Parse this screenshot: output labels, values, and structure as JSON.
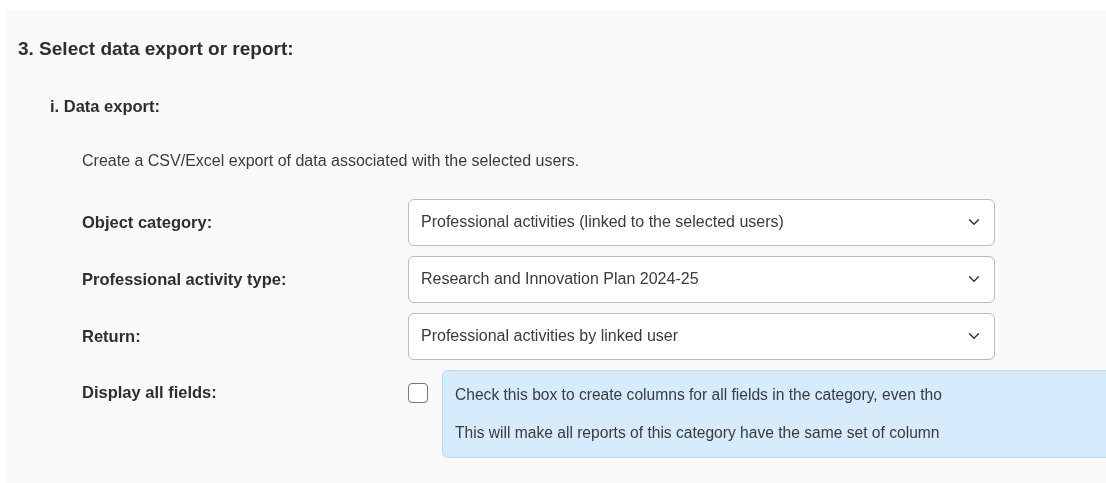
{
  "section": {
    "heading": "3. Select data export or report:",
    "subsection": {
      "heading": "i. Data export:",
      "description": "Create a CSV/Excel export of data associated with the selected users.",
      "fields": [
        {
          "kind": "select",
          "label": "Object category:",
          "value": "Professional activities (linked to the selected users)"
        },
        {
          "kind": "select",
          "label": "Professional activity type:",
          "value": "Research and Innovation Plan 2024-25"
        },
        {
          "kind": "select",
          "label": "Return:",
          "value": "Professional activities by linked user"
        },
        {
          "kind": "checkbox",
          "label": "Display all fields:",
          "checked": false,
          "help": [
            "Check this box to create columns for all fields in the category, even tho",
            "This will make all reports of this category have the same set of column"
          ]
        }
      ]
    }
  }
}
